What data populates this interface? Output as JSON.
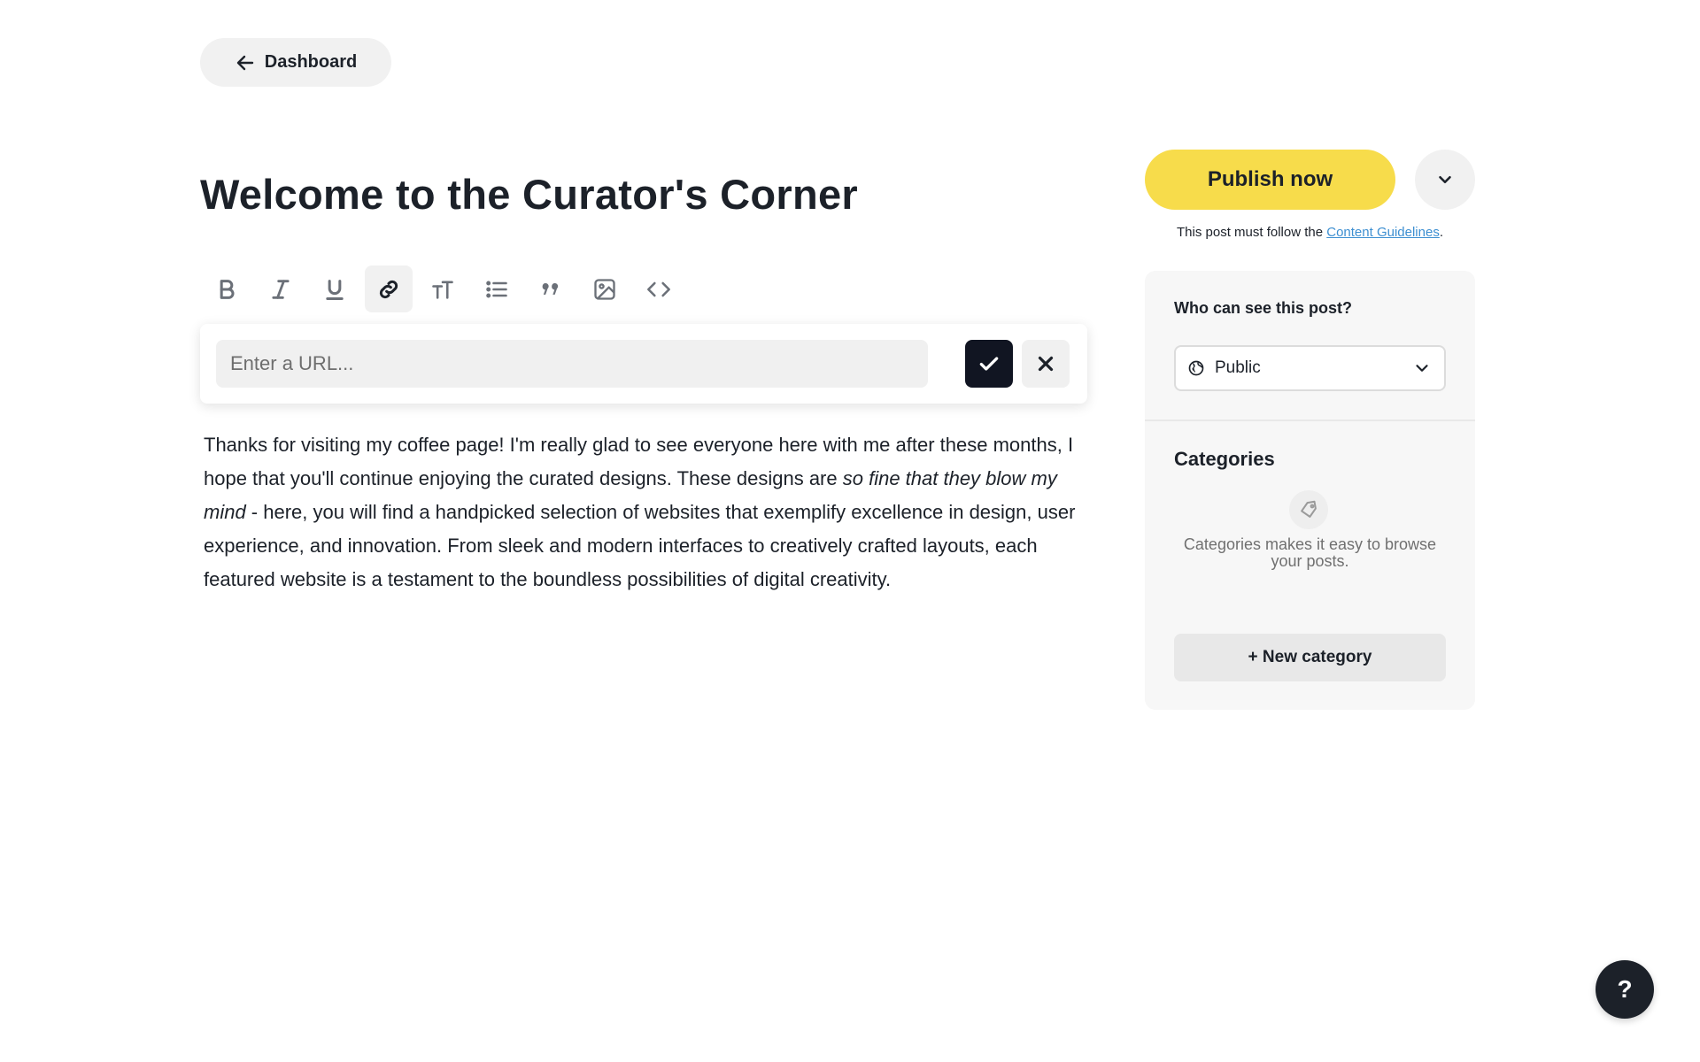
{
  "nav": {
    "back_label": "Dashboard",
    "back_icon": "arrow-left-icon"
  },
  "editor": {
    "title": "Welcome to the Curator's Corner",
    "toolbar": [
      {
        "name": "bold-button",
        "icon": "bold-icon",
        "active": false
      },
      {
        "name": "italic-button",
        "icon": "italic-icon",
        "active": false
      },
      {
        "name": "underline-button",
        "icon": "underline-icon",
        "active": false
      },
      {
        "name": "link-button",
        "icon": "link-icon",
        "active": true
      },
      {
        "name": "text-size-button",
        "icon": "text-size-icon",
        "active": false
      },
      {
        "name": "bullet-list-button",
        "icon": "list-icon",
        "active": false
      },
      {
        "name": "quote-button",
        "icon": "quote-icon",
        "active": false
      },
      {
        "name": "image-button",
        "icon": "image-icon",
        "active": false
      },
      {
        "name": "code-button",
        "icon": "code-icon",
        "active": false
      }
    ],
    "url_popup": {
      "placeholder": "Enter a URL...",
      "value": ""
    },
    "body": {
      "part1": "Thanks for visiting my coffee page! I'm really glad to see everyone here with me after these months, I hope that you'll continue enjoying the curated designs. These designs are ",
      "italic": "so fine that they blow my mind",
      "part2": " - here, you will find a handpicked selection of websites that exemplify excellence in design, user experience, and innovation. From sleek and modern interfaces to creatively crafted layouts, each featured website is a testament to the boundless possibilities of digital creativity."
    }
  },
  "sidebar": {
    "publish_label": "Publish now",
    "guidelines_prefix": "This post must follow the ",
    "guidelines_link": "Content Guidelines",
    "guidelines_suffix": ".",
    "visibility": {
      "label": "Who can see this post?",
      "value": "Public",
      "icon": "globe-icon"
    },
    "categories": {
      "label": "Categories",
      "empty_text": "Categories makes it easy to browse your posts.",
      "new_label": "+ New category"
    }
  },
  "help": {
    "label": "?"
  },
  "colors": {
    "publish": "#f7dc4b",
    "dark": "#1c2129",
    "link": "#3d8fd1",
    "panel": "#f7f7f7"
  }
}
